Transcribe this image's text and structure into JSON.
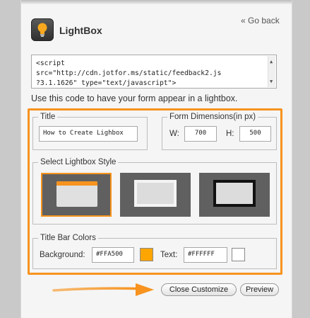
{
  "header": {
    "title": "LightBox",
    "icon": "lightbulb-icon",
    "go_back": "« Go back"
  },
  "code": {
    "lines": [
      "<script",
      "src=\"http://cdn.jotfor.ms/static/feedback2.js",
      "?3.1.1626\" type=\"text/javascript\">"
    ]
  },
  "hint": "Use this code to have your form appear in a lightbox.",
  "title_section": {
    "legend": "Title",
    "value": "How to Create Lighbox"
  },
  "dimensions": {
    "legend": "Form Dimensions(in px)",
    "width_label": "W:",
    "width_value": "700",
    "height_label": "H:",
    "height_value": "500"
  },
  "style_section": {
    "legend": "Select Lightbox Style",
    "options": [
      "orange-titlebar-style",
      "light-border-style",
      "black-border-style"
    ],
    "selected": 0
  },
  "colors_section": {
    "legend": "Title Bar Colors",
    "background_label": "Background:",
    "background_value": "#FFA500",
    "text_label": "Text:",
    "text_value": "#FFFFFF"
  },
  "buttons": {
    "close_customize": "Close Customize",
    "preview": "Preview"
  },
  "accent_color": "#f7931e"
}
